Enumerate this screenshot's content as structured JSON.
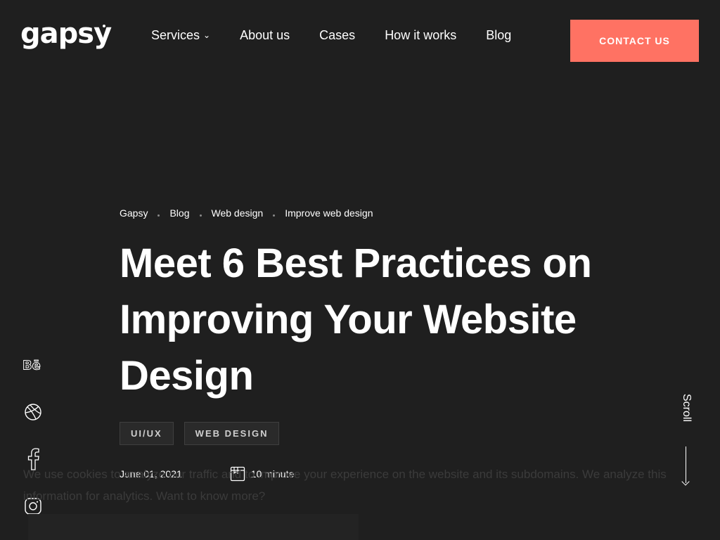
{
  "brand": {
    "logo_text": "gapsy"
  },
  "nav": {
    "items": [
      "Services",
      "About us",
      "Cases",
      "How it works",
      "Blog"
    ],
    "services_chevron_icon": "chevron-down-icon"
  },
  "header": {
    "contact_label": "CONTACT US",
    "contact_color": "#ff7263"
  },
  "breadcrumb": [
    "Gapsy",
    "Blog",
    "Web design",
    "Improve web design"
  ],
  "article": {
    "title": "Meet 6 Best Practices on Improving Your Website Design",
    "tags": [
      "UI/UX",
      "WEB DESIGN"
    ],
    "date": "June 01, 2021",
    "read_time": "10 minute",
    "read_time_icon": "book-icon"
  },
  "social": [
    "behance-icon",
    "dribbble-icon",
    "facebook-icon",
    "instagram-icon"
  ],
  "scroll": {
    "label": "Scroll"
  },
  "cookie": {
    "text": "We use cookies to analyze our traffic and to improve your experience on the website and its subdomains. We analyze this information for analytics. Want to know more?"
  },
  "colors": {
    "background": "#1f1f1f",
    "accent": "#ff7263"
  }
}
